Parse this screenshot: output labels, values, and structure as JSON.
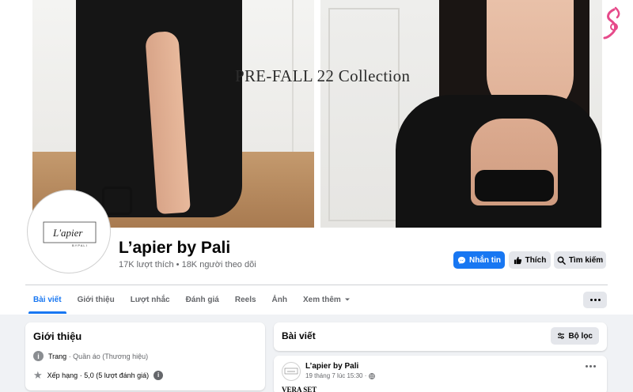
{
  "cover": {
    "title": "PRE-FALL 22 Collection"
  },
  "avatar": {
    "brand_main": "L'apier",
    "brand_sub": "BYPALI"
  },
  "page": {
    "name": "L’apier by Pali",
    "stats": "17K lượt thích • 18K người theo dõi"
  },
  "actions": {
    "message": "Nhắn tin",
    "like": "Thích",
    "search": "Tìm kiếm"
  },
  "tabs": [
    {
      "label": "Bài viết",
      "active": true
    },
    {
      "label": "Giới thiệu"
    },
    {
      "label": "Lượt nhắc"
    },
    {
      "label": "Đánh giá"
    },
    {
      "label": "Reels"
    },
    {
      "label": "Ảnh"
    },
    {
      "label": "Xem thêm"
    }
  ],
  "intro": {
    "title": "Giới thiệu",
    "type_label": "Trang",
    "type_value": " · Quần áo (Thương hiệu)",
    "rating_label": "Xếp hạng · 5,0 (5 lượt đánh giá)"
  },
  "posts": {
    "title": "Bài viết",
    "filter": "Bộ lọc"
  },
  "post": {
    "author": "L’apier by Pali",
    "time": "19 tháng 7 lúc 15:30 ·",
    "text": "VERA SET"
  },
  "colors": {
    "accent": "#1877f2",
    "muted": "#65676b",
    "button_bg": "#e4e6eb"
  }
}
